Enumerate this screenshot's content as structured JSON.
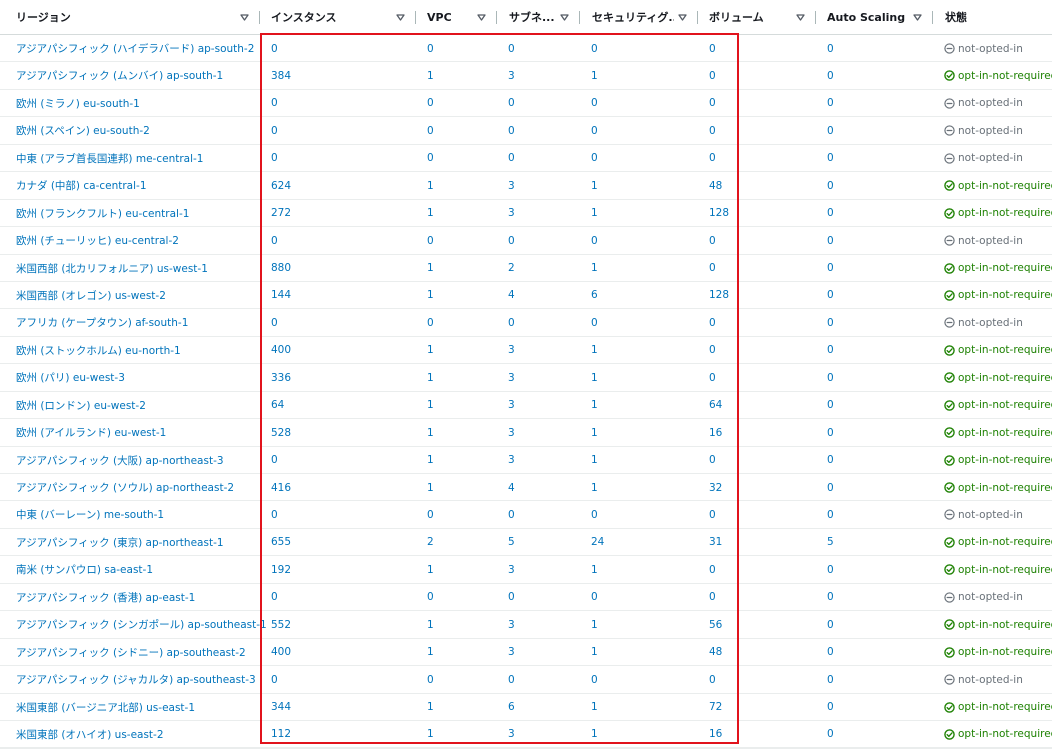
{
  "columns": [
    {
      "key": "region",
      "label": "リージョン"
    },
    {
      "key": "instances",
      "label": "インスタンス"
    },
    {
      "key": "vpc",
      "label": "VPC"
    },
    {
      "key": "subnets",
      "label": "サブネ..."
    },
    {
      "key": "security_groups",
      "label": "セキュリティグ..."
    },
    {
      "key": "volumes",
      "label": "ボリューム"
    },
    {
      "key": "autoscaling",
      "label": "Auto Scaling G..."
    },
    {
      "key": "status",
      "label": "状態"
    }
  ],
  "rows": [
    {
      "region": "アジアパシフィック (ハイデラバード) ap-south-2",
      "instances": "0",
      "vpc": "0",
      "subnets": "0",
      "security_groups": "0",
      "volumes": "0",
      "autoscaling": "0",
      "status": "not-opted-in"
    },
    {
      "region": "アジアパシフィック (ムンバイ) ap-south-1",
      "instances": "384",
      "vpc": "1",
      "subnets": "3",
      "security_groups": "1",
      "volumes": "0",
      "autoscaling": "0",
      "status": "opt-in-not-required"
    },
    {
      "region": "欧州 (ミラノ) eu-south-1",
      "instances": "0",
      "vpc": "0",
      "subnets": "0",
      "security_groups": "0",
      "volumes": "0",
      "autoscaling": "0",
      "status": "not-opted-in"
    },
    {
      "region": "欧州 (スペイン) eu-south-2",
      "instances": "0",
      "vpc": "0",
      "subnets": "0",
      "security_groups": "0",
      "volumes": "0",
      "autoscaling": "0",
      "status": "not-opted-in"
    },
    {
      "region": "中東 (アラブ首長国連邦) me-central-1",
      "instances": "0",
      "vpc": "0",
      "subnets": "0",
      "security_groups": "0",
      "volumes": "0",
      "autoscaling": "0",
      "status": "not-opted-in"
    },
    {
      "region": "カナダ (中部) ca-central-1",
      "instances": "624",
      "vpc": "1",
      "subnets": "3",
      "security_groups": "1",
      "volumes": "48",
      "autoscaling": "0",
      "status": "opt-in-not-required"
    },
    {
      "region": "欧州 (フランクフルト) eu-central-1",
      "instances": "272",
      "vpc": "1",
      "subnets": "3",
      "security_groups": "1",
      "volumes": "128",
      "autoscaling": "0",
      "status": "opt-in-not-required"
    },
    {
      "region": "欧州 (チューリッヒ) eu-central-2",
      "instances": "0",
      "vpc": "0",
      "subnets": "0",
      "security_groups": "0",
      "volumes": "0",
      "autoscaling": "0",
      "status": "not-opted-in"
    },
    {
      "region": "米国西部 (北カリフォルニア) us-west-1",
      "instances": "880",
      "vpc": "1",
      "subnets": "2",
      "security_groups": "1",
      "volumes": "0",
      "autoscaling": "0",
      "status": "opt-in-not-required"
    },
    {
      "region": "米国西部 (オレゴン) us-west-2",
      "instances": "144",
      "vpc": "1",
      "subnets": "4",
      "security_groups": "6",
      "volumes": "128",
      "autoscaling": "0",
      "status": "opt-in-not-required"
    },
    {
      "region": "アフリカ (ケープタウン) af-south-1",
      "instances": "0",
      "vpc": "0",
      "subnets": "0",
      "security_groups": "0",
      "volumes": "0",
      "autoscaling": "0",
      "status": "not-opted-in"
    },
    {
      "region": "欧州 (ストックホルム) eu-north-1",
      "instances": "400",
      "vpc": "1",
      "subnets": "3",
      "security_groups": "1",
      "volumes": "0",
      "autoscaling": "0",
      "status": "opt-in-not-required"
    },
    {
      "region": "欧州 (パリ) eu-west-3",
      "instances": "336",
      "vpc": "1",
      "subnets": "3",
      "security_groups": "1",
      "volumes": "0",
      "autoscaling": "0",
      "status": "opt-in-not-required"
    },
    {
      "region": "欧州 (ロンドン) eu-west-2",
      "instances": "64",
      "vpc": "1",
      "subnets": "3",
      "security_groups": "1",
      "volumes": "64",
      "autoscaling": "0",
      "status": "opt-in-not-required"
    },
    {
      "region": "欧州 (アイルランド) eu-west-1",
      "instances": "528",
      "vpc": "1",
      "subnets": "3",
      "security_groups": "1",
      "volumes": "16",
      "autoscaling": "0",
      "status": "opt-in-not-required"
    },
    {
      "region": "アジアパシフィック (大阪) ap-northeast-3",
      "instances": "0",
      "vpc": "1",
      "subnets": "3",
      "security_groups": "1",
      "volumes": "0",
      "autoscaling": "0",
      "status": "opt-in-not-required"
    },
    {
      "region": "アジアパシフィック (ソウル) ap-northeast-2",
      "instances": "416",
      "vpc": "1",
      "subnets": "4",
      "security_groups": "1",
      "volumes": "32",
      "autoscaling": "0",
      "status": "opt-in-not-required"
    },
    {
      "region": "中東 (バーレーン) me-south-1",
      "instances": "0",
      "vpc": "0",
      "subnets": "0",
      "security_groups": "0",
      "volumes": "0",
      "autoscaling": "0",
      "status": "not-opted-in"
    },
    {
      "region": "アジアパシフィック (東京) ap-northeast-1",
      "instances": "655",
      "vpc": "2",
      "subnets": "5",
      "security_groups": "24",
      "volumes": "31",
      "autoscaling": "5",
      "status": "opt-in-not-required"
    },
    {
      "region": "南米 (サンパウロ) sa-east-1",
      "instances": "192",
      "vpc": "1",
      "subnets": "3",
      "security_groups": "1",
      "volumes": "0",
      "autoscaling": "0",
      "status": "opt-in-not-required"
    },
    {
      "region": "アジアパシフィック (香港) ap-east-1",
      "instances": "0",
      "vpc": "0",
      "subnets": "0",
      "security_groups": "0",
      "volumes": "0",
      "autoscaling": "0",
      "status": "not-opted-in"
    },
    {
      "region": "アジアパシフィック (シンガポール) ap-southeast-1",
      "instances": "552",
      "vpc": "1",
      "subnets": "3",
      "security_groups": "1",
      "volumes": "56",
      "autoscaling": "0",
      "status": "opt-in-not-required"
    },
    {
      "region": "アジアパシフィック (シドニー) ap-southeast-2",
      "instances": "400",
      "vpc": "1",
      "subnets": "3",
      "security_groups": "1",
      "volumes": "48",
      "autoscaling": "0",
      "status": "opt-in-not-required"
    },
    {
      "region": "アジアパシフィック (ジャカルタ) ap-southeast-3",
      "instances": "0",
      "vpc": "0",
      "subnets": "0",
      "security_groups": "0",
      "volumes": "0",
      "autoscaling": "0",
      "status": "not-opted-in"
    },
    {
      "region": "米国東部 (バージニア北部) us-east-1",
      "instances": "344",
      "vpc": "1",
      "subnets": "6",
      "security_groups": "1",
      "volumes": "72",
      "autoscaling": "0",
      "status": "opt-in-not-required"
    },
    {
      "region": "米国東部 (オハイオ) us-east-2",
      "instances": "112",
      "vpc": "1",
      "subnets": "3",
      "security_groups": "1",
      "volumes": "16",
      "autoscaling": "0",
      "status": "opt-in-not-required"
    }
  ],
  "icons": {
    "sort": "caret-down-icon",
    "status_ok": "check-circle-icon",
    "status_off": "minus-circle-icon"
  },
  "colors": {
    "link": "#0073bb",
    "status_ok": "#1d8102",
    "status_off": "#687078",
    "highlight": "#e1131c",
    "header_text": "#16191f",
    "row_border": "#eaeded"
  }
}
